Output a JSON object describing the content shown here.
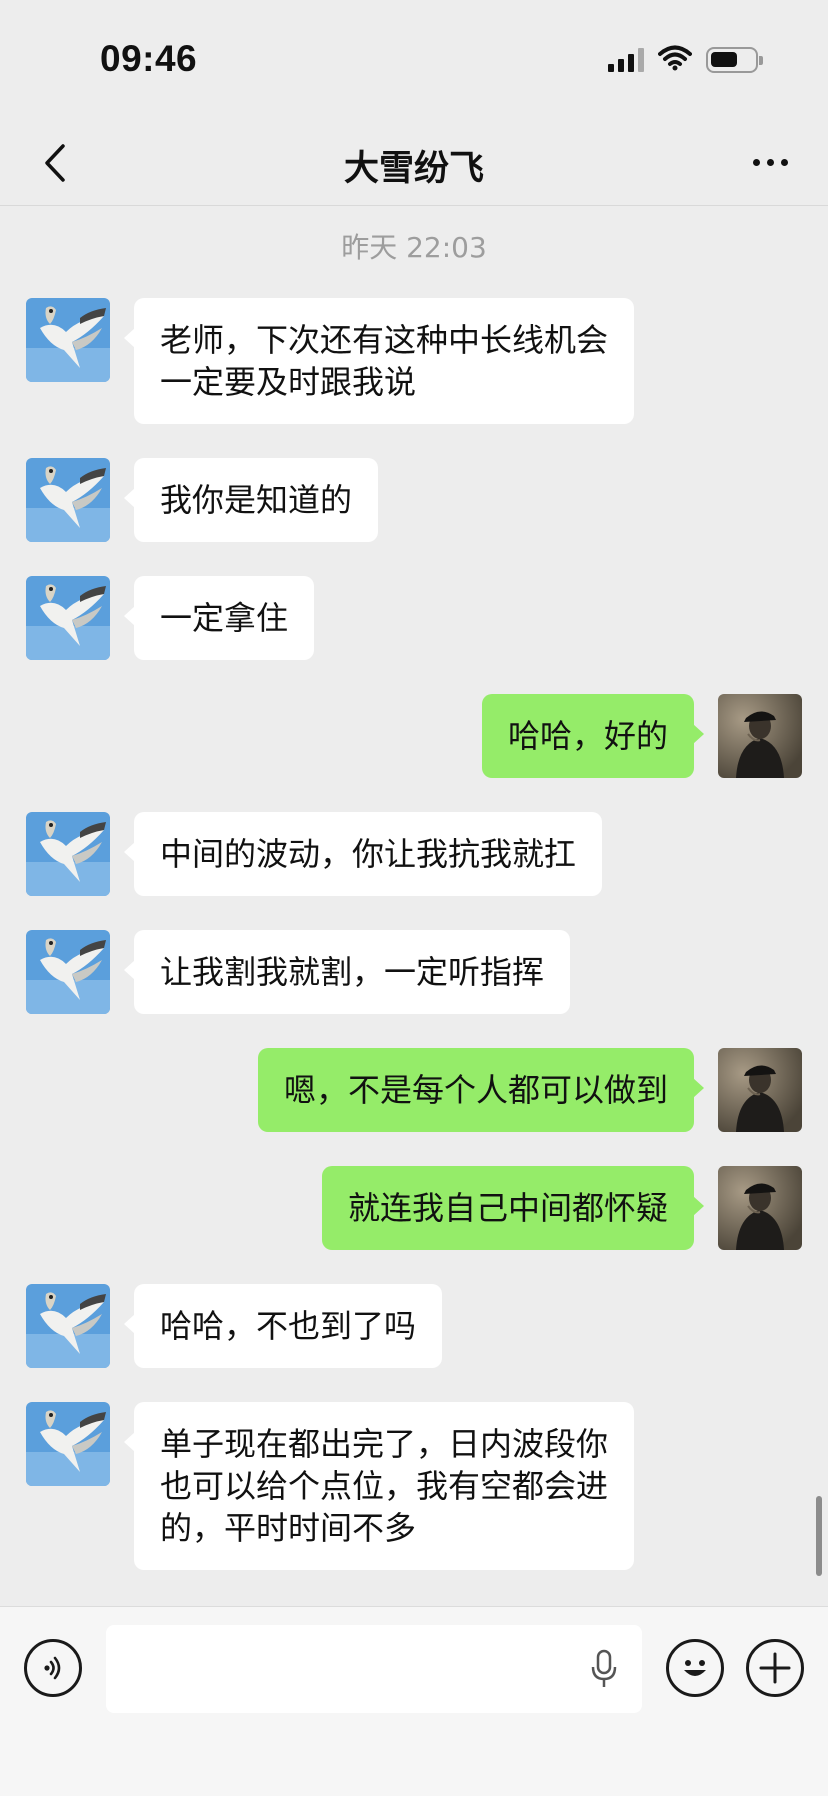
{
  "status_bar": {
    "time": "09:46"
  },
  "nav": {
    "title": "大雪纷飞"
  },
  "chat": {
    "timestamp": "昨天 22:03",
    "messages": [
      {
        "side": "left",
        "text": "老师，下次还有这种中长线机会\n一定要及时跟我说"
      },
      {
        "side": "left",
        "text": "我你是知道的"
      },
      {
        "side": "left",
        "text": "一定拿住"
      },
      {
        "side": "right",
        "text": "哈哈，好的"
      },
      {
        "side": "left",
        "text": "中间的波动，你让我抗我就扛"
      },
      {
        "side": "left",
        "text": "让我割我就割，一定听指挥"
      },
      {
        "side": "right",
        "text": "嗯，不是每个人都可以做到"
      },
      {
        "side": "right",
        "text": "就连我自己中间都怀疑"
      },
      {
        "side": "left",
        "text": "哈哈，不也到了吗"
      },
      {
        "side": "left",
        "text": "单子现在都出完了，日内波段你\n也可以给个点位，我有空都会进\n的，平时时间不多"
      }
    ]
  },
  "input": {
    "value": ""
  },
  "icons": {
    "back": "chevron-left-icon",
    "more": "more-dots-icon",
    "voice": "voice-mode-icon",
    "mic": "microphone-icon",
    "emoji": "emoji-icon",
    "add": "plus-icon"
  },
  "colors": {
    "background": "#ededed",
    "bubble_self": "#95ec69",
    "bubble_other": "#ffffff",
    "timestamp": "#9d9d9d"
  }
}
